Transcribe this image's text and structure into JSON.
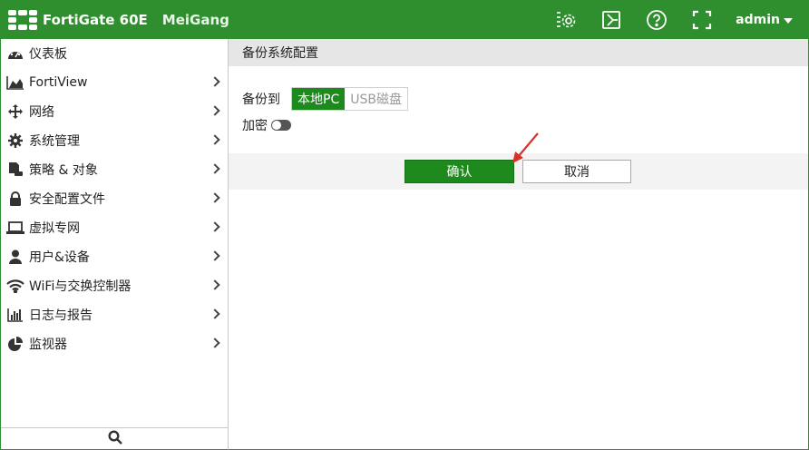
{
  "header": {
    "brand": "FortiGate 60E",
    "hostname": "MeiGang",
    "admin_label": "admin",
    "icons": [
      "cli-console-icon",
      "fullscreen-video-icon",
      "help-icon",
      "expand-icon"
    ]
  },
  "sidebar": {
    "items": [
      {
        "label": "仪表板",
        "icon": "dashboard-icon",
        "has_arrow": false
      },
      {
        "label": "FortiView",
        "icon": "area-chart-icon",
        "has_arrow": true
      },
      {
        "label": "网络",
        "icon": "arrows-move-icon",
        "has_arrow": true
      },
      {
        "label": "系统管理",
        "icon": "gear-icon",
        "has_arrow": true
      },
      {
        "label": "策略 & 对象",
        "icon": "policy-icon",
        "has_arrow": true
      },
      {
        "label": "安全配置文件",
        "icon": "lock-icon",
        "has_arrow": true
      },
      {
        "label": "虚拟专网",
        "icon": "laptop-icon",
        "has_arrow": true
      },
      {
        "label": "用户&设备",
        "icon": "user-icon",
        "has_arrow": true
      },
      {
        "label": "WiFi与交换控制器",
        "icon": "wifi-icon",
        "has_arrow": true
      },
      {
        "label": "日志与报告",
        "icon": "bar-chart-icon",
        "has_arrow": true
      },
      {
        "label": "监视器",
        "icon": "pie-chart-icon",
        "has_arrow": true
      }
    ],
    "search_icon": "search-icon"
  },
  "main": {
    "section_title": "备份系统配置",
    "backup_to_label": "备份到",
    "backup_options": [
      "本地PC",
      "USB磁盘"
    ],
    "backup_selected": "本地PC",
    "encrypt_label": "加密",
    "encrypt_enabled": false,
    "ok_label": "确认",
    "cancel_label": "取消"
  },
  "colors": {
    "brand_green": "#2f8f2f",
    "button_green": "#1e8a1e",
    "annotation_red": "#d9322a"
  }
}
